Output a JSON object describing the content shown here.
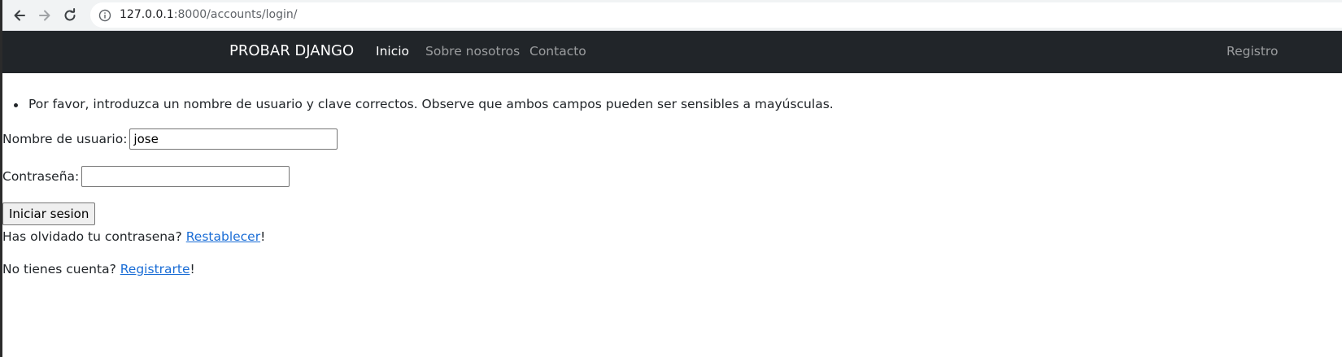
{
  "browser": {
    "url_host": "127.0.0.1",
    "url_rest": ":8000/accounts/login/",
    "back_icon": "arrow-left-icon",
    "forward_icon": "arrow-right-icon",
    "reload_icon": "reload-icon",
    "info_icon": "info-icon"
  },
  "navbar": {
    "brand": "PROBAR DJANGO",
    "links": [
      {
        "label": "Inicio",
        "active": true
      },
      {
        "label": "Sobre nosotros",
        "active": false
      },
      {
        "label": "Contacto",
        "active": false
      }
    ],
    "register_label": "Registro"
  },
  "form": {
    "errors": [
      "Por favor, introduzca un nombre de usuario y clave correctos. Observe que ambos campos pueden ser sensibles a mayúsculas."
    ],
    "username_label": "Nombre de usuario:",
    "username_value": "jose",
    "password_label": "Contraseña:",
    "password_value": "",
    "submit_label": "Iniciar sesion"
  },
  "footer_links": {
    "forgot_prefix": "Has olvidado tu contrasena? ",
    "forgot_link": "Restablecer",
    "forgot_suffix": "!",
    "signup_prefix": "No tienes cuenta? ",
    "signup_link": "Registrarte",
    "signup_suffix": "!"
  },
  "colors": {
    "navbar_bg": "#212529",
    "link": "#1a6dd6"
  }
}
